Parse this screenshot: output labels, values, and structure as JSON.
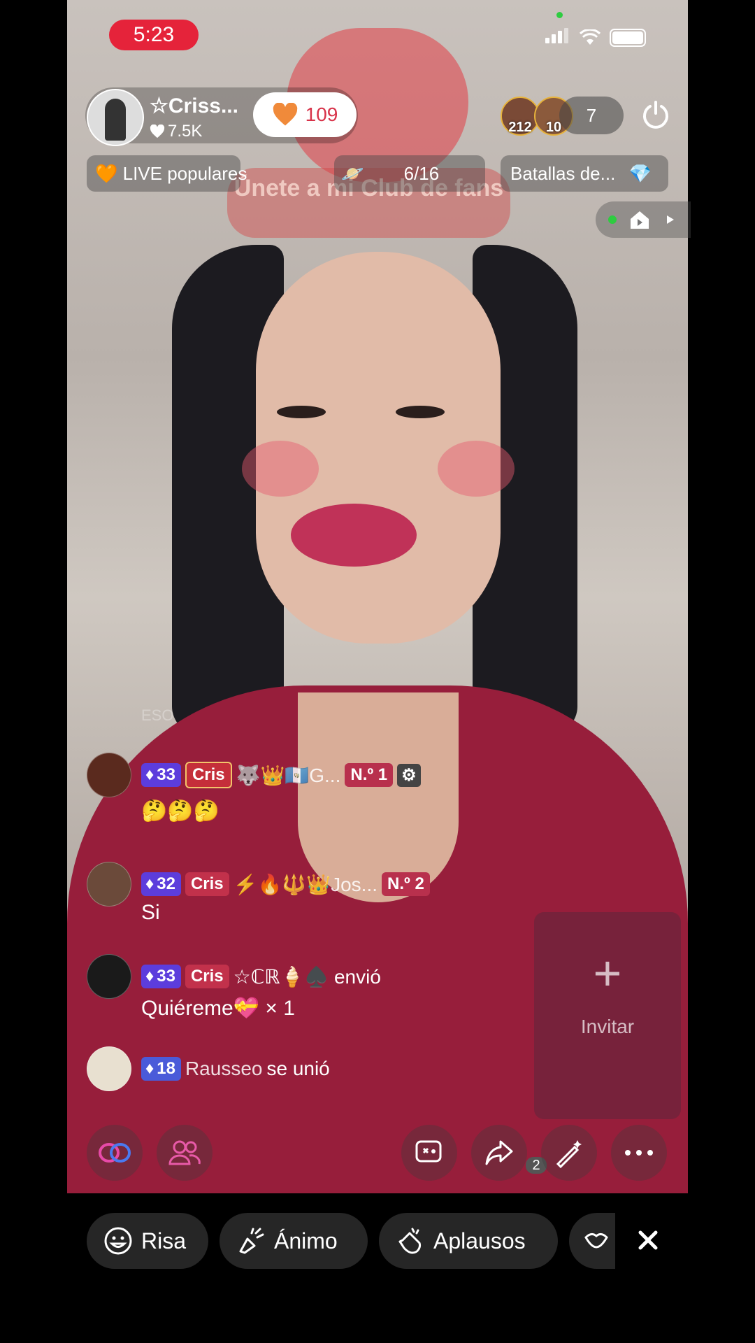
{
  "status_bar": {
    "time": "5:23"
  },
  "host": {
    "name": "☆Criss...",
    "likes": "7.5K",
    "fan_score": "109"
  },
  "viewers": {
    "top1_score": "212",
    "top2_score": "10",
    "count": "7"
  },
  "badges": {
    "live_popular": "LIVE populares",
    "ranking": "6/16",
    "battles": "Batallas de..."
  },
  "overlay": {
    "club_banner": "Únete a mi Club de fans"
  },
  "chat": {
    "faded": "ESO",
    "messages": [
      {
        "level": "33",
        "fan_badge": "Cris",
        "username": "🐺👑🇬🇹G...",
        "rank": "N.º 1",
        "text": "🤔🤔🤔"
      },
      {
        "level": "32",
        "fan_badge": "Cris",
        "username": "⚡🔥🔱👑Jos...",
        "rank": "N.º 2",
        "text": "Si"
      },
      {
        "level": "33",
        "fan_badge": "Cris",
        "username": "☆ℂℝ🍦♠️ envió",
        "text": "Quiéreme💝 × 1"
      },
      {
        "level": "18",
        "username": "Rausseo",
        "text": "se unió"
      }
    ]
  },
  "invite": {
    "label": "Invitar"
  },
  "share_count": "2",
  "reactions": [
    {
      "label": "Risa",
      "icon": "laugh-icon"
    },
    {
      "label": "Ánimo",
      "icon": "cheer-icon"
    },
    {
      "label": "Aplausos",
      "icon": "clap-icon"
    }
  ]
}
